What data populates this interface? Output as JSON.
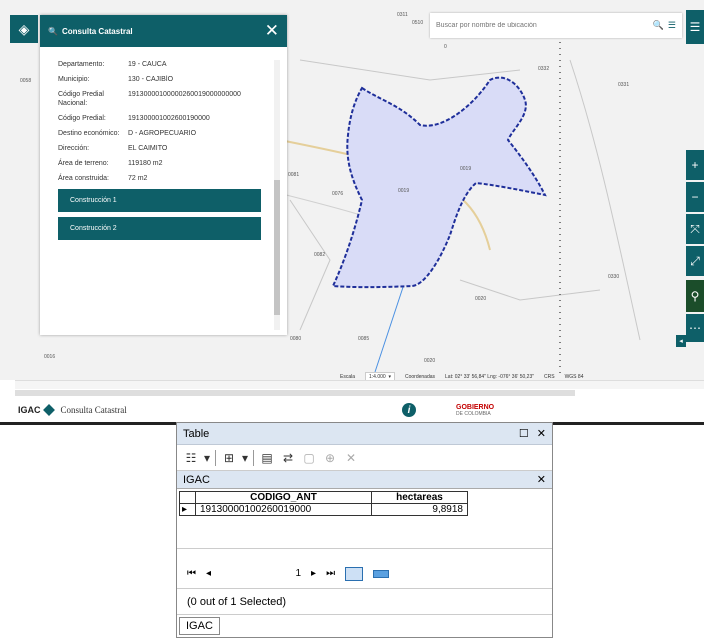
{
  "app": {
    "panel_title": "Consulta Catastral",
    "footer_title": "Consulta Catastral",
    "logo_text": "IGAC",
    "gob_text": "GOBIERNO",
    "gob_sub": "DE COLOMBIA"
  },
  "search": {
    "placeholder": "Buscar por nombre de ubicación"
  },
  "attributes": [
    {
      "key": "Departamento:",
      "value": "19 - CAUCA"
    },
    {
      "key": "Municipio:",
      "value": "130 - CAJIBÍO"
    },
    {
      "key": "Código Predial Nacional:",
      "value": "19130000100000260019000000000"
    },
    {
      "key": "Código Predial:",
      "value": "191300001002600190000"
    },
    {
      "key": "Destino económico:",
      "value": "D - AGROPECUARIO"
    },
    {
      "key": "Dirección:",
      "value": "EL CAIMITO"
    },
    {
      "key": "Área de terreno:",
      "value": "119180 m2"
    },
    {
      "key": "Área construida:",
      "value": "72 m2"
    }
  ],
  "construcciones": [
    "Construcción 1",
    "Construcción 2"
  ],
  "map_labels": [
    "0311",
    "0510",
    "0332",
    "0331",
    "0058",
    "0019",
    "0076",
    "0019",
    "0081",
    "0082",
    "0020",
    "0330",
    "0080",
    "0085",
    "0016",
    "0020",
    "0"
  ],
  "status": {
    "scale_label": "Escala",
    "scale_value": "1:4.000",
    "coords_label": "Coordenadas",
    "coords_value": "Lat: 02° 33' 56,84\" Lng: -076° 36' 50,23\"",
    "crs_label": "CRS",
    "crs_value": "WGS 84"
  },
  "table": {
    "window_title": "Table",
    "tab_title": "IGAC",
    "columns": [
      "CODIGO_ANT",
      "hectareas"
    ],
    "rows": [
      [
        "19130000100260019000",
        "9,8918"
      ]
    ],
    "page_number": "1",
    "selection_info": "(0 out of 1 Selected)",
    "bottom_tab": "IGAC"
  },
  "colors": {
    "accent": "#0e5f68",
    "parcel_fill": "#d9dcf7",
    "parcel_stroke": "#1f2f9a"
  }
}
